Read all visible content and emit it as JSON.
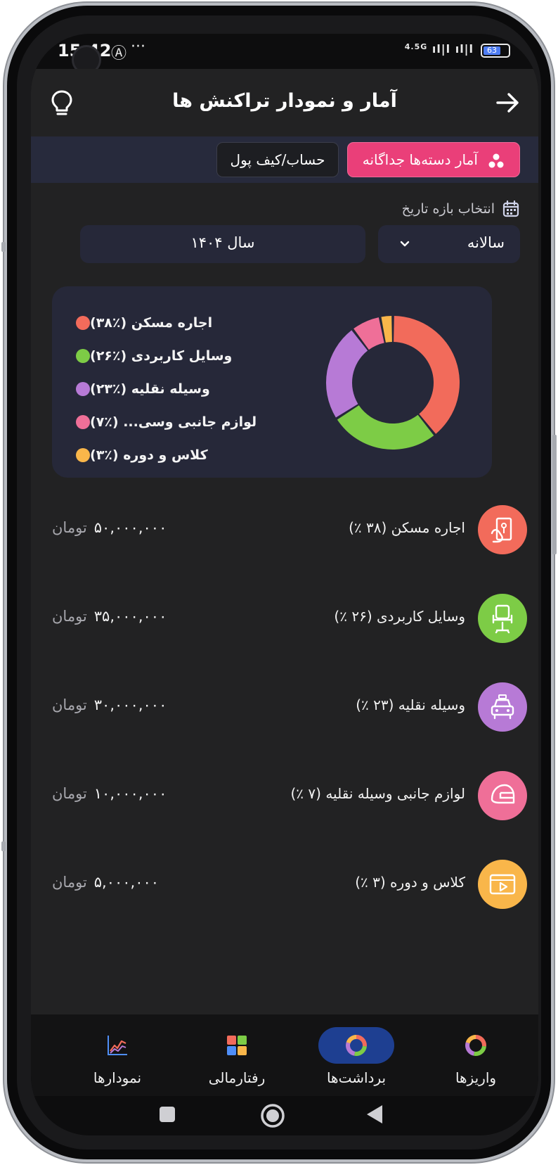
{
  "status_bar": {
    "time": "15:42",
    "network": "4.5G",
    "battery": "63"
  },
  "header": {
    "title": "آمار و نمودار تراکنش ها",
    "back_icon": "arrow-right-icon",
    "tip_icon": "lightbulb-icon"
  },
  "tabs": [
    {
      "label": "آمار دسته‌ها جداگانه",
      "active": true
    },
    {
      "label": "حساب/کیف پول",
      "active": false
    }
  ],
  "filters": {
    "range_label": "انتخاب بازه تاریخ",
    "period": "سالانه",
    "year": "سال ۱۴۰۴"
  },
  "chart_data": {
    "type": "pie",
    "variant": "donut",
    "categories": [
      "اجاره مسکن",
      "وسایل کاربردی",
      "وسیله نقلیه",
      "لوازم جانبی وسیله نقلیه",
      "کلاس و دوره"
    ],
    "values": [
      38,
      26,
      23,
      7,
      3
    ],
    "colors": [
      "#f26b5b",
      "#7dcc46",
      "#b77ad6",
      "#ef6f98",
      "#f9b64a"
    ],
    "legend": [
      "اجاره مسکن (٪۳۸)",
      "وسایل کاربردی (٪۲۶)",
      "وسیله نقلیه (٪۲۳)",
      "لوازم جانبی وسی... (٪۷)",
      "کلاس و دوره (٪۳)"
    ],
    "legend_position": "left"
  },
  "categories": [
    {
      "name": "اجاره مسکن (٣٨ ٪)",
      "amount": "۵۰,۰۰۰,۰۰۰",
      "currency": "تومان",
      "color": "#f26b5b",
      "icon": "house-key-icon"
    },
    {
      "name": "وسایل کاربردی (۲۶ ٪)",
      "amount": "۳۵,۰۰۰,۰۰۰",
      "currency": "تومان",
      "color": "#7dcc46",
      "icon": "office-chair-icon"
    },
    {
      "name": "وسیله نقلیه (۲۳ ٪)",
      "amount": "۳۰,۰۰۰,۰۰۰",
      "currency": "تومان",
      "color": "#b77ad6",
      "icon": "taxi-icon"
    },
    {
      "name": "لوازم جانبی وسیله نقلیه (۷ ٪)",
      "amount": "۱۰,۰۰۰,۰۰۰",
      "currency": "تومان",
      "color": "#ef6f98",
      "icon": "helmet-icon"
    },
    {
      "name": "کلاس و دوره (۳ ٪)",
      "amount": "۵,۰۰۰,۰۰۰",
      "currency": "تومان",
      "color": "#f9b64a",
      "icon": "video-course-icon"
    }
  ],
  "bottom_nav": [
    {
      "label": "واریزها",
      "icon": "donut-chart-icon",
      "active": false
    },
    {
      "label": "برداشت‌ها",
      "icon": "donut-chart-icon",
      "active": true
    },
    {
      "label": "رفتارمالی",
      "icon": "grid-tiles-icon",
      "active": false
    },
    {
      "label": "نمودارها",
      "icon": "line-chart-icon",
      "active": false
    }
  ],
  "colors": {
    "background": "#222223",
    "card": "#262839",
    "accent": "#ea3f79",
    "nav_active": "#1e3f91"
  }
}
